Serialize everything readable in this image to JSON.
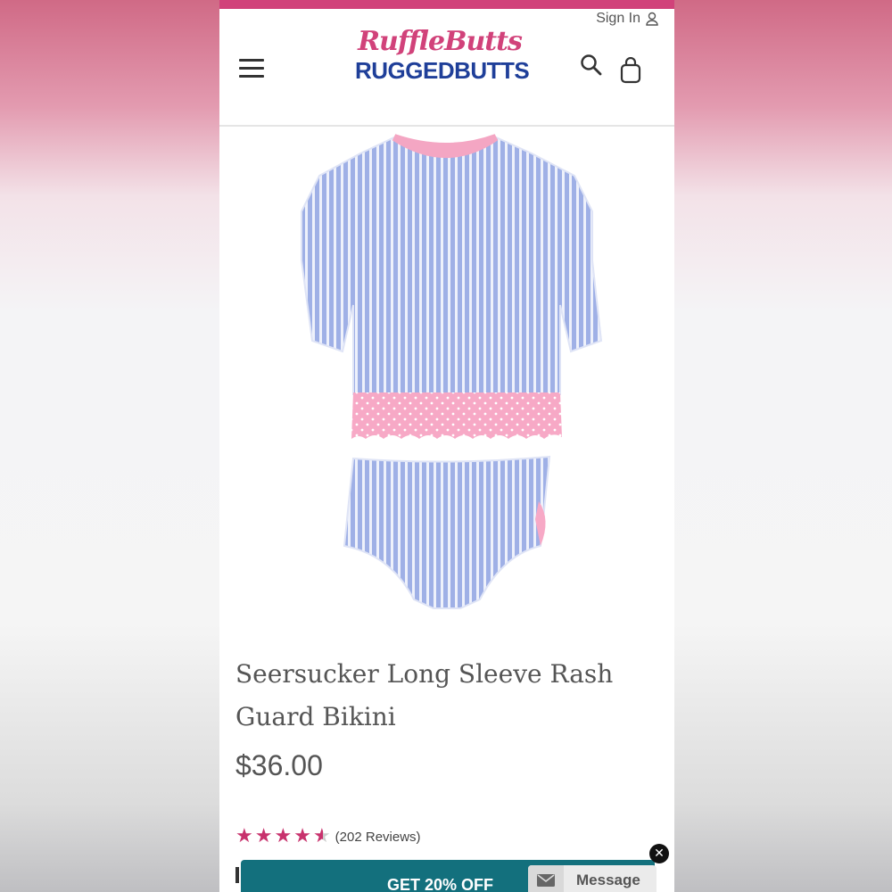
{
  "header": {
    "sign_in": "Sign In",
    "logo_top": "RuffleButts",
    "logo_bottom": "RUGGEDBUTTS",
    "icons": [
      "hamburger-menu-icon",
      "user-icon",
      "search-icon",
      "shopping-bag-icon"
    ]
  },
  "gallery": {
    "image_alt": "Seersucker rash guard top and bikini bottom",
    "slide_count": 9,
    "active_slide": 1
  },
  "product": {
    "title": "Seersucker Long Sleeve Rash Guard Bikini",
    "price": "$36.00",
    "rating": 4.5,
    "reviews": "(202 Reviews)"
  },
  "promo": {
    "text": "GET 20% OFF",
    "close": "✕"
  },
  "chat": {
    "label": "Message"
  },
  "colors": {
    "brand_pink": "#d1427a",
    "brand_blue": "#1f3f99",
    "promo_teal": "#13707d",
    "star": "#c8326d"
  }
}
